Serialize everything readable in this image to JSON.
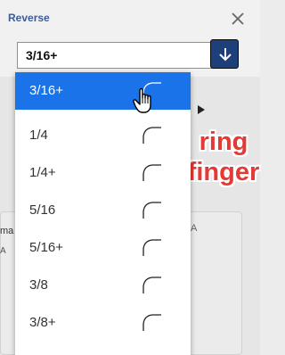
{
  "panel": {
    "title": "Reverse",
    "close_glyph": "×"
  },
  "select": {
    "value": "3/16+",
    "arrow_icon": "arrow-down-icon"
  },
  "callout": {
    "line1": "ring",
    "line2": "finger",
    "color": "#e53935"
  },
  "dropdown": {
    "options": [
      {
        "label": "3/16+",
        "selected": true
      },
      {
        "label": "1/4",
        "selected": false
      },
      {
        "label": "1/4+",
        "selected": false
      },
      {
        "label": "5/16",
        "selected": false
      },
      {
        "label": "5/16+",
        "selected": false
      },
      {
        "label": "3/8",
        "selected": false
      },
      {
        "label": "3/8+",
        "selected": false
      }
    ],
    "option_icon": "curve-profile-icon",
    "selected_color": "#1a73e8"
  },
  "background": {
    "card_text": "ma",
    "glyph_a": "A",
    "glyph_b": "A"
  },
  "colors": {
    "accent": "#1a73e8",
    "title": "#3b5c9a",
    "arrow_button": "#1d3f7a"
  }
}
